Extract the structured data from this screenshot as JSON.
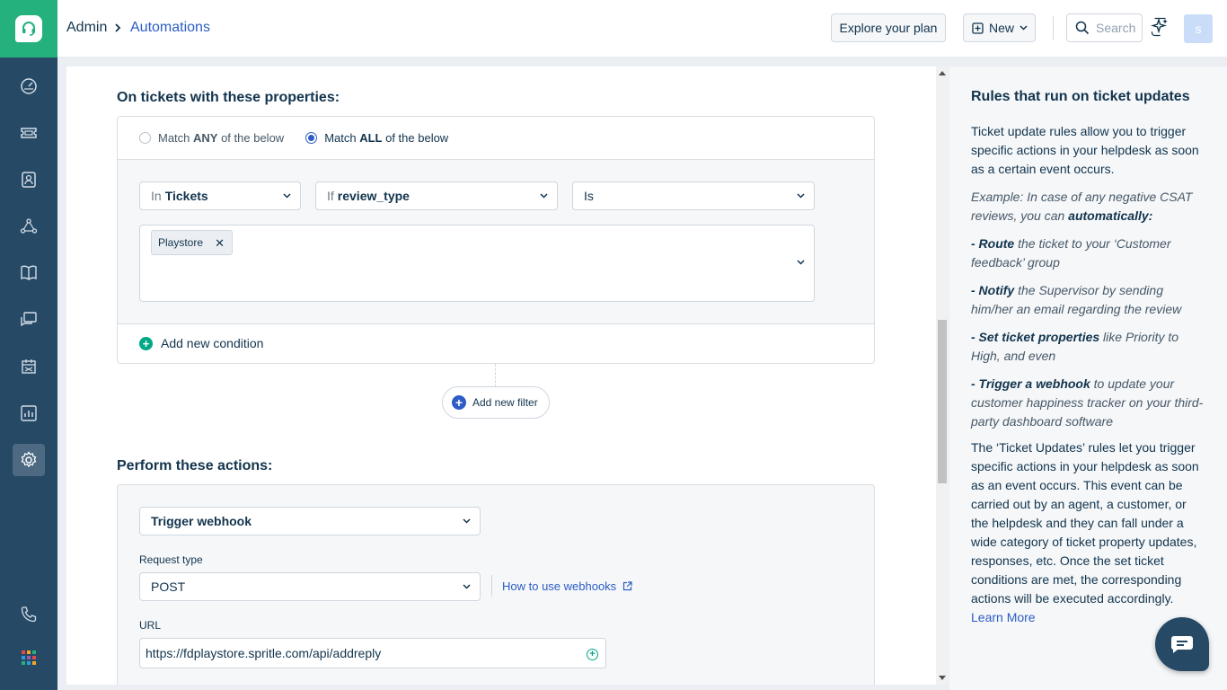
{
  "header": {
    "breadcrumb_root": "Admin",
    "breadcrumb_current": "Automations",
    "explore_label": "Explore your plan",
    "new_label": "New",
    "search_placeholder": "Search",
    "avatar_initial": "s"
  },
  "nav": {
    "icons": [
      "dashboard-icon",
      "tickets-icon",
      "contacts-icon",
      "groups-icon",
      "solutions-icon",
      "forums-icon",
      "admin-icon",
      "reports-icon",
      "settings-icon",
      "phone-icon",
      "apps-grid-icon"
    ],
    "active": "settings-icon"
  },
  "conditions": {
    "title": "On tickets with these properties:",
    "match_any": {
      "pre": "Match ",
      "bold": "ANY",
      "post": " of the below",
      "selected": false
    },
    "match_all": {
      "pre": "Match ",
      "bold": "ALL",
      "post": " of the below",
      "selected": true
    },
    "row": {
      "entity_prefix": "In",
      "entity": "Tickets",
      "field_prefix": "If",
      "field": "review_type",
      "operator": "Is",
      "values": [
        "Playstore"
      ]
    },
    "add_condition_label": "Add new condition",
    "add_filter_label": "Add new filter"
  },
  "actions": {
    "title": "Perform these actions:",
    "action_type": "Trigger webhook",
    "request_type_label": "Request type",
    "request_type_value": "POST",
    "webhook_help_label": "How to use webhooks",
    "url_label": "URL",
    "url_value": "https://fdplaystore.spritle.com/api/addreply"
  },
  "help_panel": {
    "title": "Rules that run on ticket updates",
    "intro": "Ticket update rules allow you to trigger specific actions in your helpdesk as soon as a certain event occurs.",
    "example_pre": "Example: In case of any negative CSAT reviews, you can ",
    "example_bold": "automatically:",
    "bullets": [
      {
        "bold": "- Route",
        "rest": " the ticket to your ‘Customer feedback’ group"
      },
      {
        "bold": "- Notify",
        "rest": " the Supervisor by sending him/her an email regarding the review"
      },
      {
        "bold": "- Set ticket properties",
        "rest": " like Priority to High, and even"
      },
      {
        "bold": "- Trigger a webhook",
        "rest": " to update your customer happiness tracker on your third-party dashboard software"
      }
    ],
    "body": "The ‘Ticket Updates’ rules let you trigger specific actions in your helpdesk as soon as an event occurs. This event can be carried out by an agent, a customer, or the helpdesk and they can fall under a wide category of ticket property updates, responses, etc. Once the set ticket conditions are met, the corresponding actions will be executed accordingly.",
    "learn_more": "Learn More"
  },
  "colors": {
    "nav_bg": "#264966",
    "brand_green": "#25b17d",
    "link_blue": "#2c5cc5",
    "add_green": "#00a886"
  }
}
